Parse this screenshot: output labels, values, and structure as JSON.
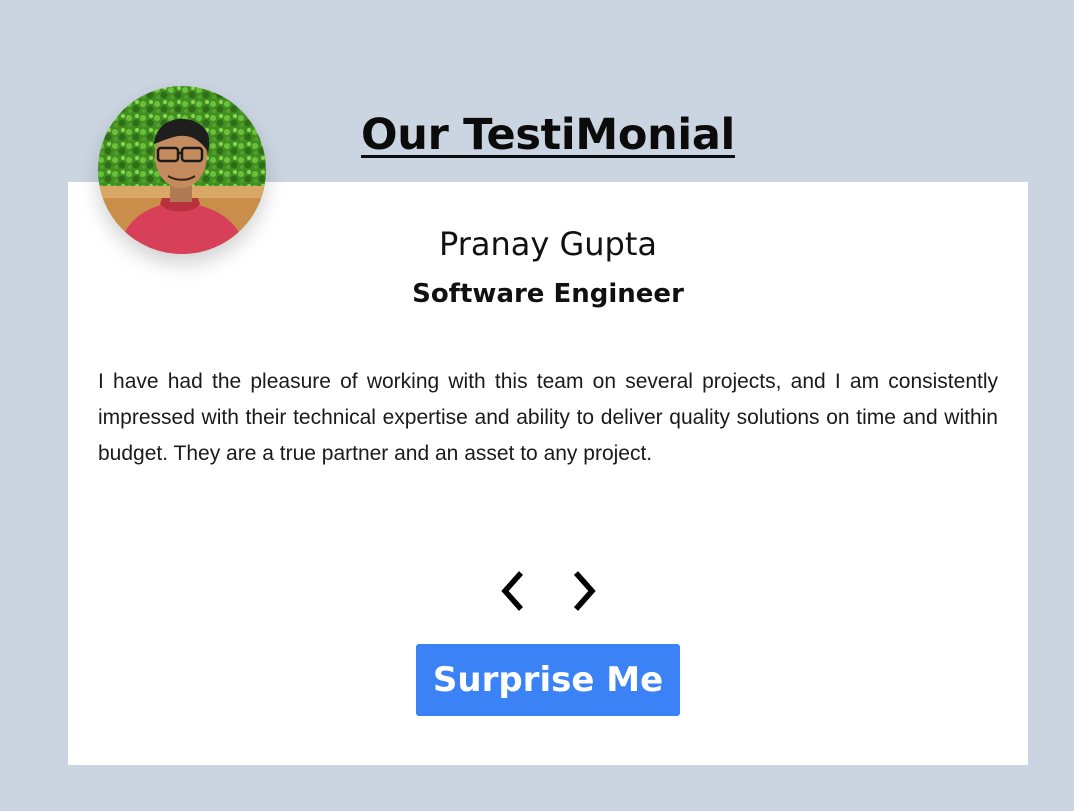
{
  "page": {
    "heading": "Our TestiMonial"
  },
  "testimonial": {
    "name": "Pranay Gupta",
    "role": "Software Engineer",
    "text": "I have had the pleasure of working with this team on several projects, and I am consistently impressed with their technical expertise and ability to deliver quality solutions on time and within budget. They are a true partner and an asset to any project.",
    "avatar_icon": "person-photo"
  },
  "controls": {
    "prev_icon": "chevron-left-icon",
    "next_icon": "chevron-right-icon",
    "surprise_label": "Surprise Me"
  },
  "colors": {
    "page_background": "#cbd5e1",
    "card_background": "#ffffff",
    "button_background": "#3b82f6",
    "button_text": "#ffffff"
  }
}
